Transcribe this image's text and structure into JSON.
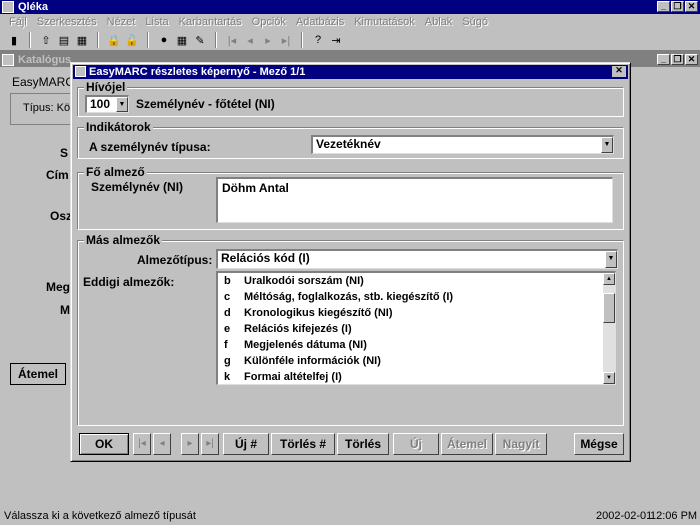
{
  "app": {
    "title": "Qléka",
    "menu": [
      "Fájl",
      "Szerkesztés",
      "Nézet",
      "Lista",
      "Karbantartás",
      "Opciók",
      "Adatbázis",
      "Kimutatások",
      "Ablak",
      "Súgó"
    ],
    "caption_buttons": [
      "_",
      "❐",
      "✕"
    ]
  },
  "toolbar": {
    "icons": [
      "book-icon",
      "upload-icon",
      "books-icon",
      "notebook-icon",
      "lock-icon",
      "unlock-icon",
      "globe-icon",
      "grid-icon",
      "edit-icon",
      "first-icon",
      "prev-icon",
      "next-icon",
      "last-icon",
      "help-icon",
      "exit-icon"
    ],
    "glyphs": [
      "▮",
      "⇧",
      "▤",
      "▦",
      "🔒",
      "🔓",
      "●",
      "▦",
      "✎",
      "|◂",
      "◂",
      "▸",
      "▸|",
      "?",
      "⇥"
    ]
  },
  "background_window": {
    "title": "Katalógus",
    "heading": "EasyMARC",
    "type_label": "Típus: Kön",
    "fragment_labels": [
      "S",
      "Cím",
      "Osz",
      "Meg",
      "M"
    ],
    "atemel_button": "Átemel",
    "caption_buttons": [
      "_",
      "❐",
      "✕"
    ]
  },
  "dialog": {
    "title": "EasyMARC részletes képernyő - Mező 1/1",
    "close": "✕",
    "hivojel": {
      "group_label": "Hívójel",
      "value": "100",
      "description": "Személynév - főtétel (NI)"
    },
    "indikatorok": {
      "group_label": "Indikátorok",
      "label": "A személynév típusa:",
      "value": "Vezetéknév"
    },
    "fo_almezo": {
      "group_label": "Fő almező",
      "label": "Személynév (NI)",
      "value": "Döhm Antal"
    },
    "mas_almezok": {
      "group_label": "Más almezők",
      "type_label": "Almezőtípus:",
      "type_value": "Relációs kód (I)",
      "list_label": "Eddigi almezők:",
      "items": [
        {
          "code": "b",
          "text": "Uralkodói sorszám (NI)"
        },
        {
          "code": "c",
          "text": "Méltóság, foglalkozás, stb. kiegészítő (I)"
        },
        {
          "code": "d",
          "text": "Kronologikus kiegészítő (NI)"
        },
        {
          "code": "e",
          "text": "Relációs kifejezés (I)"
        },
        {
          "code": "f",
          "text": "Megjelenés dátuma (NI)"
        },
        {
          "code": "g",
          "text": "Különféle információk (NI)"
        },
        {
          "code": "k",
          "text": "Formai altételfej (I)"
        }
      ]
    },
    "buttons": {
      "ok": "OK",
      "uj_hash": "Új #",
      "torles_hash": "Törlés #",
      "torles": "Törlés",
      "uj": "Új",
      "atemel": "Átemel",
      "nagyit": "Nagyít",
      "megse": "Mégse"
    },
    "nav_glyphs": [
      "|◂",
      "◂",
      "▸",
      "▸|"
    ]
  },
  "status": {
    "text": "Válassza ki a következő almező típusát",
    "date": "2002-02-01",
    "time": "12:06 PM"
  }
}
